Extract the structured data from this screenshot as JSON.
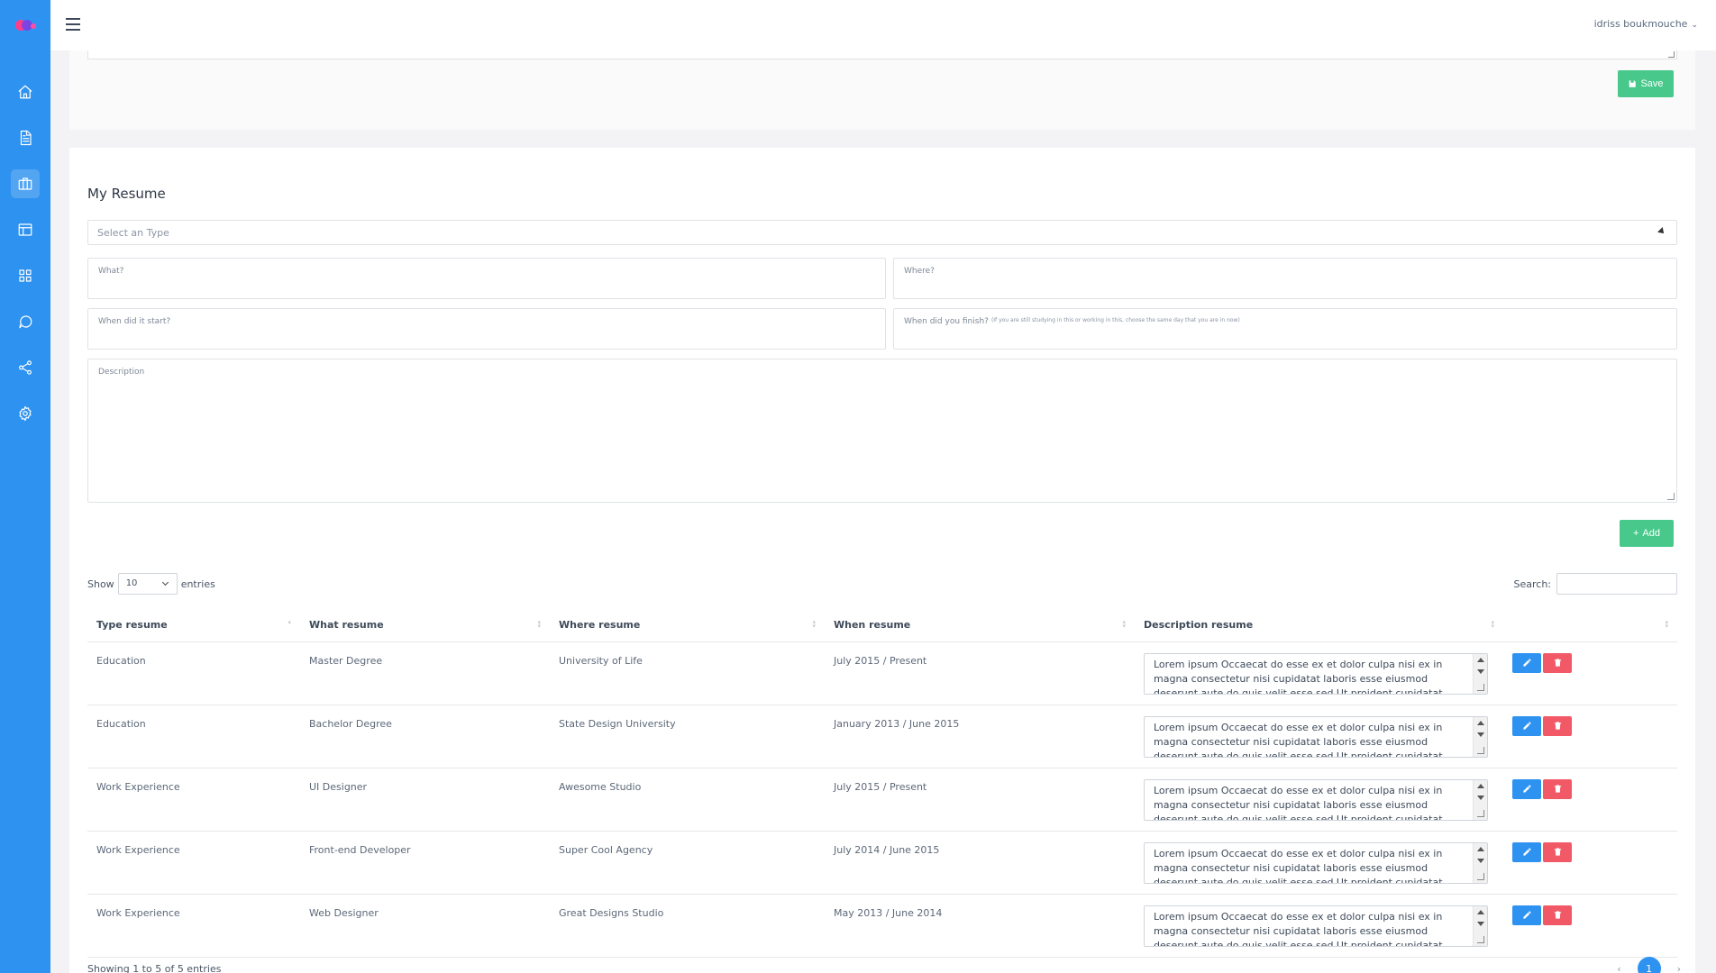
{
  "header": {
    "user_name": "idriss boukmouche"
  },
  "sidebar": {
    "icons": [
      "home-icon",
      "document-icon",
      "briefcase-icon",
      "layout-icon",
      "grid-icon",
      "chat-icon",
      "share-icon",
      "settings-icon"
    ],
    "active_index": 2
  },
  "top_card": {
    "save_label": "Save"
  },
  "resume": {
    "title": "My Resume",
    "type_placeholder": "Select an Type",
    "what_label": "What?",
    "where_label": "Where?",
    "start_label": "When did it start?",
    "finish_label": "When did you finish?",
    "finish_note": "(If you are still studying in this or working in this, choose the same day that you are in now)",
    "description_label": "Description",
    "add_label": "Add"
  },
  "table_controls": {
    "show_label": "Show",
    "entries_label": "entries",
    "page_length": "10",
    "search_label": "Search:"
  },
  "table": {
    "columns": [
      "Type resume",
      "What resume",
      "Where resume",
      "When resume",
      "Description resume",
      ""
    ],
    "rows": [
      {
        "type": "Education",
        "what": "Master Degree",
        "where": "University of Life",
        "when": "July 2015 / Present",
        "description": "Lorem ipsum Occaecat do esse ex et dolor culpa nisi ex in magna consectetur nisi cupidatat laboris esse eiusmod deserunt aute do quis velit esse sed Ut proident cupidatat nulla esse nulla dolor"
      },
      {
        "type": "Education",
        "what": "Bachelor Degree",
        "where": "State Design University",
        "when": "January 2013 / June 2015",
        "description": "Lorem ipsum Occaecat do esse ex et dolor culpa nisi ex in magna consectetur nisi cupidatat laboris esse eiusmod deserunt aute do quis velit esse sed Ut proident cupidatat nulla esse nulla dolor"
      },
      {
        "type": "Work Experience",
        "what": "UI Designer",
        "where": "Awesome Studio",
        "when": "July 2015 / Present",
        "description": "Lorem ipsum Occaecat do esse ex et dolor culpa nisi ex in magna consectetur nisi cupidatat laboris esse eiusmod deserunt aute do quis velit esse sed Ut proident cupidatat nulla esse nulla dolor"
      },
      {
        "type": "Work Experience",
        "what": "Front-end Developer",
        "where": "Super Cool Agency",
        "when": "July 2014 / June 2015",
        "description": "Lorem ipsum Occaecat do esse ex et dolor culpa nisi ex in magna consectetur nisi cupidatat laboris esse eiusmod deserunt aute do quis velit esse sed Ut proident cupidatat nulla esse nulla dolor"
      },
      {
        "type": "Work Experience",
        "what": "Web Designer",
        "where": "Great Designs Studio",
        "when": "May 2013 / June 2014",
        "description": "Lorem ipsum Occaecat do esse ex et dolor culpa nisi ex in magna consectetur nisi cupidatat laboris esse eiusmod deserunt aute do quis velit esse sed Ut proident cupidatat nulla esse nulla dolor"
      }
    ]
  },
  "footer": {
    "info": "Showing 1 to 5 of 5 entries",
    "prev": "‹",
    "current_page": "1",
    "next": "›"
  },
  "colors": {
    "primary": "#2e92f0",
    "success": "#48c98b",
    "danger": "#f25967"
  }
}
